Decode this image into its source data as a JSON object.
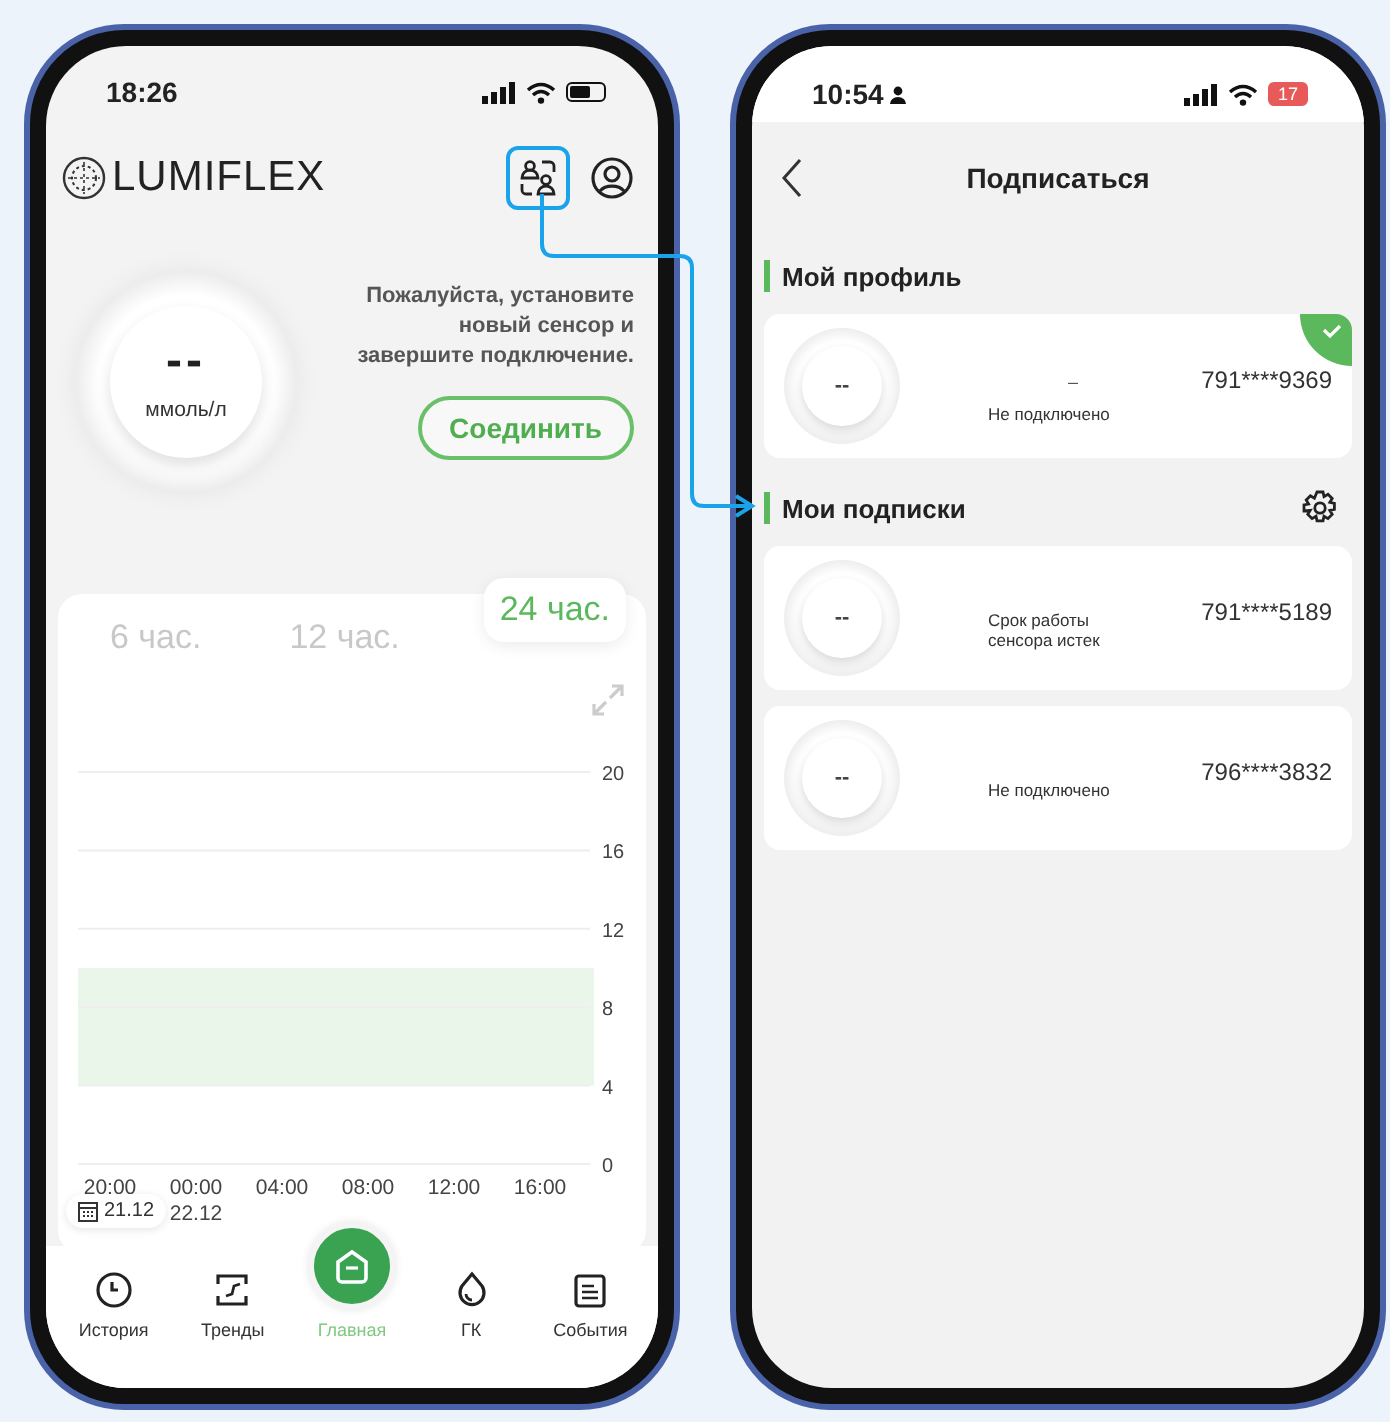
{
  "left_phone": {
    "status_bar": {
      "time": "18:26"
    },
    "header": {
      "logo": "LUMIFLEX"
    },
    "reading": {
      "value": "--",
      "unit": "ммоль/л"
    },
    "message": "Пожалуйста, установите новый сенсор и завершите подключение.",
    "connect_button": "Соединить",
    "range_tabs": [
      {
        "label": "6 час.",
        "selected": false
      },
      {
        "label": "12 час.",
        "selected": false
      },
      {
        "label": "24 час.",
        "selected": true
      }
    ],
    "chart": {
      "chart_data": {
        "type": "line",
        "categories": [
          "20:00",
          "00:00",
          "04:00",
          "08:00",
          "12:00",
          "16:00"
        ],
        "ylim": [
          0,
          20
        ],
        "yticks": [
          0,
          4,
          8,
          12,
          16,
          20
        ],
        "grid": true,
        "bands": [
          {
            "axis": "y",
            "from": 4,
            "to": 10
          }
        ]
      },
      "date_label": "22.12",
      "date_chip": "21.12"
    },
    "nav": [
      {
        "kind": "history",
        "label": "История",
        "selected": false
      },
      {
        "kind": "trends",
        "label": "Тренды",
        "selected": false
      },
      {
        "kind": "home",
        "label": "Главная",
        "selected": true
      },
      {
        "kind": "drop",
        "label": "ГК",
        "selected": false
      },
      {
        "kind": "events",
        "label": "События",
        "selected": false
      }
    ]
  },
  "right_phone": {
    "status_bar": {
      "time": "10:54",
      "battery": "17"
    },
    "title": "Подписаться",
    "sections": [
      {
        "title": "Мой профиль",
        "settings": false,
        "items": [
          {
            "reading": "--",
            "name": "–",
            "status": "Не подключено",
            "phone": "791****9369",
            "selected": true
          }
        ]
      },
      {
        "title": "Мои подписки",
        "settings": true,
        "items": [
          {
            "reading": "--",
            "status": "Срок работы сенсора истек",
            "phone": "791****5189",
            "selected": false
          },
          {
            "reading": "--",
            "status": "Не подключено",
            "phone": "796****3832",
            "selected": false
          }
        ]
      }
    ]
  }
}
